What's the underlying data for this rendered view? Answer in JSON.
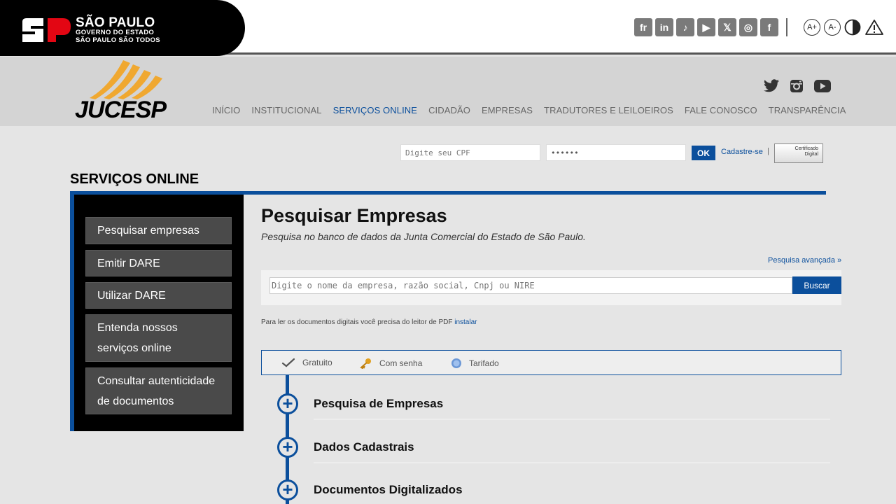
{
  "gov": {
    "line1": "SÃO PAULO",
    "line2": "GOVERNO DO ESTADO",
    "line3": "SÃO PAULO SÃO TODOS",
    "brand_red": "#e30613",
    "social": [
      {
        "icon": "flickr-icon",
        "glyph": "fr"
      },
      {
        "icon": "linkedin-icon",
        "glyph": "in"
      },
      {
        "icon": "tiktok-icon",
        "glyph": "♪"
      },
      {
        "icon": "youtube-icon",
        "glyph": "▶"
      },
      {
        "icon": "x-icon",
        "glyph": "𝕏"
      },
      {
        "icon": "instagram-icon",
        "glyph": "◎"
      },
      {
        "icon": "facebook-icon",
        "glyph": "f"
      }
    ],
    "a11y": [
      "A+",
      "A-"
    ]
  },
  "header": {
    "logo_text": "JUCESP",
    "nav": [
      {
        "label": "INÍCIO",
        "active": false
      },
      {
        "label": "INSTITUCIONAL",
        "active": false
      },
      {
        "label": "SERVIÇOS ONLINE",
        "active": true
      },
      {
        "label": "CIDADÃO",
        "active": false
      },
      {
        "label": "EMPRESAS",
        "active": false
      },
      {
        "label": "TRADUTORES E LEILOEIROS",
        "active": false
      },
      {
        "label": "FALE CONOSCO",
        "active": false
      },
      {
        "label": "TRANSPARÊNCIA",
        "active": false
      }
    ],
    "accent": "#0b4f9c"
  },
  "login": {
    "cpf_placeholder": "Digite seu CPF",
    "password_value": "••••••",
    "ok_label": "OK",
    "register_label": "Cadastre-se",
    "separator": "|",
    "cert_label_1": "Certificado",
    "cert_label_2": "Digital"
  },
  "page": {
    "heading": "SERVIÇOS ONLINE"
  },
  "sidebar": {
    "items": [
      {
        "label": "Pesquisar empresas"
      },
      {
        "label": "Emitir DARE"
      },
      {
        "label": "Utilizar DARE"
      },
      {
        "label": "Entenda nossos serviços online"
      },
      {
        "label": "Consultar autenticidade de documentos"
      }
    ]
  },
  "main": {
    "title": "Pesquisar Empresas",
    "subtitle": "Pesquisa no banco de dados da Junta Comercial do Estado de São Paulo.",
    "advanced_link": "Pesquisa avançada »",
    "search_placeholder": "Digite o nome da empresa, razão social, Cnpj ou NIRE",
    "search_button": "Buscar",
    "pdf_note": "Para ler os documentos digitais você precisa do leitor de PDF",
    "pdf_link": "instalar",
    "legend": [
      {
        "icon": "checkmark-icon",
        "label": "Gratuito"
      },
      {
        "icon": "key-icon",
        "label": "Com senha"
      },
      {
        "icon": "coin-icon",
        "label": "Tarifado"
      }
    ],
    "sections": [
      {
        "label": "Pesquisa de Empresas"
      },
      {
        "label": "Dados Cadastrais"
      },
      {
        "label": "Documentos Digitalizados"
      }
    ]
  }
}
